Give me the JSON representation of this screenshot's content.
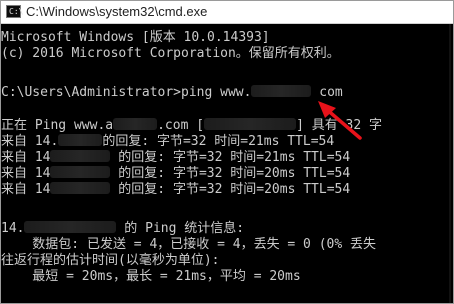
{
  "window": {
    "title": "C:\\Windows\\system32\\cmd.exe",
    "icon": "cmd-icon"
  },
  "console": {
    "lines": [
      {
        "text": "Microsoft Windows [版本 10.0.14393]"
      },
      {
        "text": "(c) 2016 Microsoft Corporation。保留所有权利。"
      },
      {
        "text": ""
      },
      {
        "pre": "C:\\Users\\Administrator>ping www.",
        "post": " com"
      },
      {
        "text": ""
      },
      {
        "pre": "正在 Ping www.a",
        "mid": ".com [",
        "post": "] 具有 32 字"
      },
      {
        "pre": "来自 14.",
        "post": "的回复: 字节=32 时间=21ms TTL=54"
      },
      {
        "pre": "来自 14",
        "post": " 的回复: 字节=32 时间=21ms TTL=54"
      },
      {
        "pre": "来自 14",
        "post": " 的回复: 字节=32 时间=20ms TTL=54"
      },
      {
        "pre": "来自 14",
        "post": " 的回复: 字节=32 时间=20ms TTL=54"
      },
      {
        "text": ""
      },
      {
        "pre": "14.",
        "post": " 的 Ping 统计信息:"
      },
      {
        "text": "    数据包: 已发送 = 4，已接收 = 4，丢失 = 0 (0% 丢失"
      },
      {
        "text": "往返行程的估计时间(以毫秒为单位):"
      },
      {
        "text": "    最短 = 20ms，最长 = 21ms，平均 = 20ms"
      }
    ]
  },
  "colors": {
    "console_bg": "#000000",
    "console_text": "#cccccc",
    "annotation_arrow": "#e8121a"
  }
}
